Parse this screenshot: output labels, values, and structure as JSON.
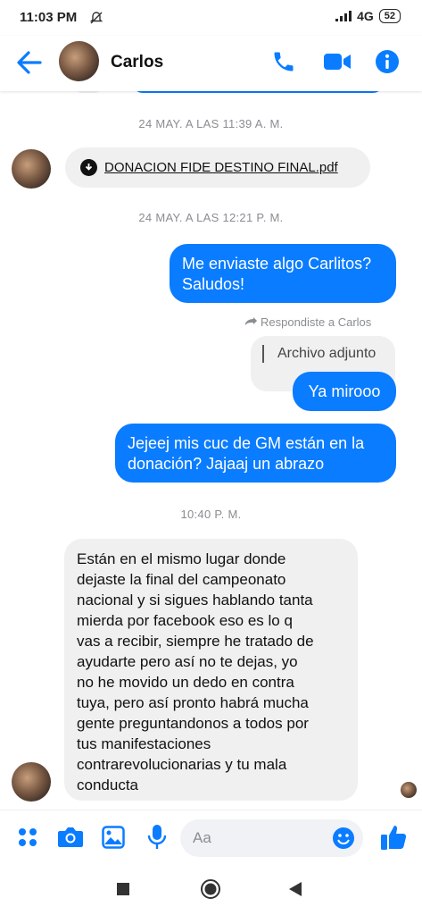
{
  "status_bar": {
    "time": "11:03 PM",
    "network": "4G",
    "battery": "52"
  },
  "header": {
    "contact_name": "Carlos",
    "icons": [
      "back-arrow-icon",
      "phone-icon",
      "video-icon",
      "info-icon"
    ]
  },
  "conversation": {
    "date_1": "24 MAY. A LAS 11:39 A. M.",
    "file_name": "DONACION FIDE DESTINO FINAL.pdf",
    "date_2": "24 MAY. A LAS 12:21 P. M.",
    "out_msg_1": "Me enviaste algo Carlitos? Saludos!",
    "reply_indicator": "Respondiste a Carlos",
    "quoted_text": "Archivo adjunto",
    "out_msg_2": "Ya mirooo",
    "out_msg_3": "Jejeej mis cuc de GM están en la donación? Jajaaj un abrazo",
    "time_3": "10:40 P. M.",
    "in_msg_long": "Están en el mismo lugar donde dejaste la final del campeonato nacional y si sigues hablando tanta mierda por facebook eso es lo q vas a recibir, siempre he tratado de ayudarte pero así no te dejas, yo no he movido un dedo en contra tuya, pero así pronto habrá mucha gente preguntandonos a todos por tus manifestaciones contrarevolucionarias y tu mala conducta"
  },
  "composer": {
    "placeholder": "Aa",
    "icons": [
      "menu-dots-icon",
      "camera-icon",
      "gallery-icon",
      "microphone-icon",
      "emoji-icon",
      "like-icon"
    ]
  },
  "colors": {
    "accent": "#0a7cff",
    "incoming_bubble": "#f0f0f0"
  }
}
